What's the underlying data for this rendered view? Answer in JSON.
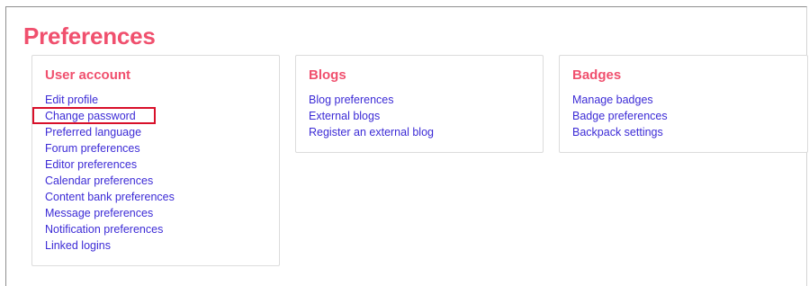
{
  "page": {
    "title": "Preferences"
  },
  "colors": {
    "heading": "#f0506e",
    "link": "#3c2bd6",
    "highlight": "#d8102a"
  },
  "cards": [
    {
      "title": "User account",
      "links": [
        "Edit profile",
        "Change password",
        "Preferred language",
        "Forum preferences",
        "Editor preferences",
        "Calendar preferences",
        "Content bank preferences",
        "Message preferences",
        "Notification preferences",
        "Linked logins"
      ]
    },
    {
      "title": "Blogs",
      "links": [
        "Blog preferences",
        "External blogs",
        "Register an external blog"
      ]
    },
    {
      "title": "Badges",
      "links": [
        "Manage badges",
        "Badge preferences",
        "Backpack settings"
      ]
    }
  ],
  "highlighted_link": "Change password"
}
